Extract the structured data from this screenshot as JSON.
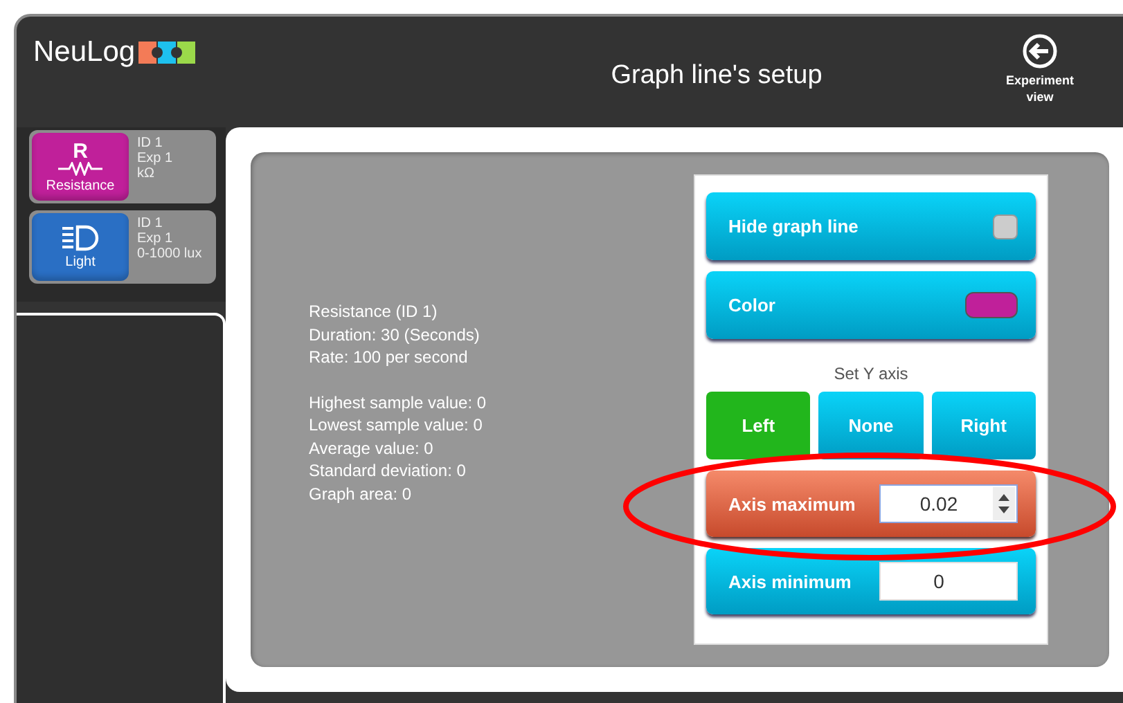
{
  "header": {
    "logo": "NeuLog",
    "title": "Graph line's setup",
    "back_button": "Experiment view"
  },
  "sensors": [
    {
      "kind": "resistance",
      "symbol": "R",
      "name": "Resistance",
      "color": "#c0209a",
      "details": [
        "ID 1",
        "Exp 1",
        "kΩ"
      ]
    },
    {
      "kind": "light",
      "name": "Light",
      "color": "#2a6fc4",
      "details": [
        "ID 1",
        "Exp 1",
        "0-1000 lux"
      ]
    }
  ],
  "info": [
    [
      "Resistance (ID 1)",
      "Duration: 30 (Seconds)",
      "Rate: 100 per second"
    ],
    [
      "Highest sample value: 0",
      "Lowest sample value: 0",
      "Average value: 0",
      "Standard deviation: 0",
      "Graph area: 0"
    ]
  ],
  "settings": {
    "hide_graph_line": {
      "label": "Hide graph line",
      "checked": false
    },
    "color": {
      "label": "Color",
      "color": "#c0209a"
    },
    "y_axis": {
      "label": "Set Y axis",
      "options": [
        {
          "label": "Left",
          "selected": true
        },
        {
          "label": "None",
          "selected": false
        },
        {
          "label": "Right",
          "selected": false
        }
      ]
    },
    "fields": [
      {
        "label": "Axis maximum",
        "value": "0.02",
        "focused": true
      },
      {
        "label": "Axis minimum",
        "value": "0",
        "focused": false
      }
    ]
  },
  "annotation": {
    "kind": "ellipse",
    "color": "#ff0000"
  }
}
